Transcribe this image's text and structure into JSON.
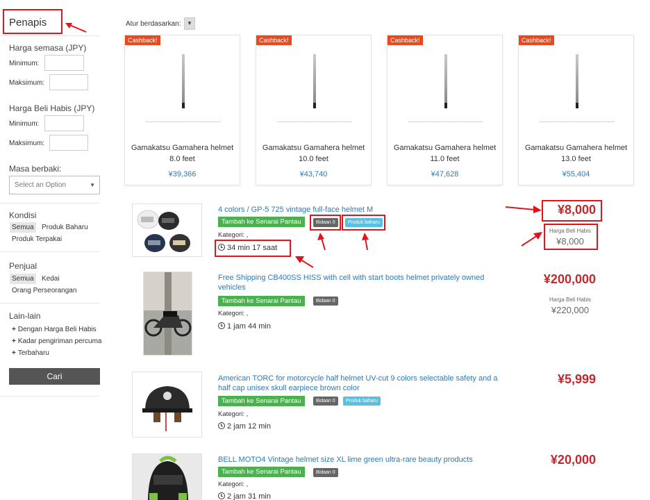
{
  "sidebar": {
    "title": "Penapis",
    "current_price_label": "Harga semasa (JPY)",
    "min_label": "Minimum:",
    "max_label": "Maksimum:",
    "buyout_price_label": "Harga Beli Habis (JPY)",
    "end_time_label": "Masa berbaki:",
    "end_time_placeholder": "Select an Option",
    "condition_label": "Kondisi",
    "condition_options": [
      "Semua",
      "Produk Baharu",
      "Produk Terpakai"
    ],
    "seller_label": "Penjual",
    "seller_options": [
      "Semua",
      "Kedai",
      "Orang Perseorangan"
    ],
    "others_label": "Lain-lain",
    "others_options": [
      "Dengan Harga Beli Habis",
      "Kadar pengiriman percuma",
      "Terbaharu"
    ],
    "search_button": "Cari"
  },
  "sort": {
    "label": "Atur berdasarkan:"
  },
  "featured": [
    {
      "badge": "Cashback!",
      "name": "Gamakatsu Gamahera helmet 8.0 feet",
      "price": "¥39,366"
    },
    {
      "badge": "Cashback!",
      "name": "Gamakatsu Gamahera helmet 10.0 feet",
      "price": "¥43,740"
    },
    {
      "badge": "Cashback!",
      "name": "Gamakatsu Gamahera helmet 11.0 feet",
      "price": "¥47,628"
    },
    {
      "badge": "Cashback!",
      "name": "Gamakatsu Gamahera helmet 13.0 feet",
      "price": "¥55,404"
    }
  ],
  "listings": [
    {
      "title": "4 colors / GP-5 725 vintage full-face helmet M",
      "watch": "Tambah ke Senarai Pantau",
      "bids": "Bidaan 0",
      "new_badge": "Produk baharu",
      "category": "Kategori: ,",
      "time": "34 min 17 saat",
      "price": "¥8,000",
      "buyout_label": "Harga Beli Habis",
      "buyout": "¥8,000"
    },
    {
      "title": "Free Shipping CB400SS HISS with cell with start boots helmet privately owned vehicles",
      "watch": "Tambah ke Senarai Pantau",
      "bids": "Bidaan 0",
      "category": "Kategori: ,",
      "time": "1 jam 44 min",
      "price": "¥200,000",
      "buyout_label": "Harga Beli Habis",
      "buyout": "¥220,000"
    },
    {
      "title": "American TORC for motorcycle half helmet UV-cut 9 colors selectable safety and a half cap unisex skull earpiece brown color",
      "watch": "Tambah ke Senarai Pantau",
      "bids": "Bidaan 0",
      "new_badge": "Produk baharu",
      "category": "Kategori: ,",
      "time": "2 jam 12 min",
      "price": "¥5,999"
    },
    {
      "title": "BELL MOTO4 Vintage helmet size XL lime green ultra-rare beauty products",
      "watch": "Tambah ke Senarai Pantau",
      "bids": "Bidaan 0",
      "category": "Kategori: ,",
      "time": "2 jam 31 min",
      "price": "¥20,000"
    }
  ],
  "colors": {
    "accent": "#2a7ab8",
    "price": "#c0292e",
    "watch": "#4caf50",
    "annotation": "#e0141b",
    "cashback": "#e8491d"
  }
}
